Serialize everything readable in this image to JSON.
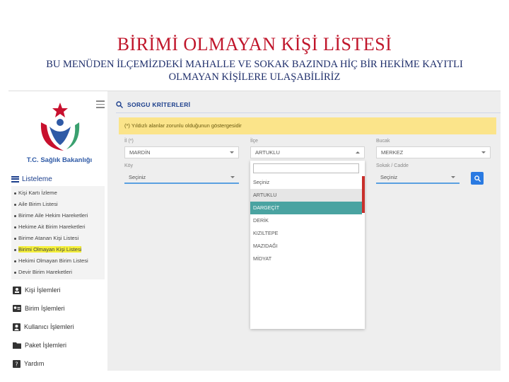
{
  "slide": {
    "title": "BİRİMİ OLMAYAN KİŞİ LİSTESİ",
    "subtitle": "BU MENÜDEN İLÇEMİZDEKİ MAHALLE VE SOKAK BAZINDA HİÇ BİR HEKİME KAYITLI OLMAYAN KİŞİLERE ULAŞABİLİRİZ"
  },
  "sidebar": {
    "ministry_name": "T.C. Sağlık Bakanlığı",
    "menu_head": "Listeleme",
    "submenu": [
      {
        "label": "Kişi Kartı İzleme"
      },
      {
        "label": "Aile Birim Listesi"
      },
      {
        "label": "Birime Aile Hekim Hareketleri"
      },
      {
        "label": "Hekime Ait Birim Hareketleri"
      },
      {
        "label": "Birime Atanan Kişi Listesi"
      },
      {
        "label": "Birimi Olmayan Kişi Listesi",
        "active": true
      },
      {
        "label": "Hekimi Olmayan Birim Listesi"
      },
      {
        "label": "Devir Birim Hareketleri"
      }
    ],
    "nav": [
      {
        "label": "Kişi İşlemleri",
        "icon": "person-card-icon"
      },
      {
        "label": "Birim İşlemleri",
        "icon": "id-card-icon"
      },
      {
        "label": "Kullanıcı İşlemleri",
        "icon": "user-icon"
      },
      {
        "label": "Paket İşlemleri",
        "icon": "folder-icon"
      },
      {
        "label": "Yardım",
        "icon": "help-icon"
      }
    ]
  },
  "query": {
    "header": "SORGU KRİTERLERİ",
    "notice": "(*) Yıldızlı alanlar zorunlu olduğunun göstergesidir",
    "fields": {
      "il_label": "İl (*)",
      "il_value": "MARDİN",
      "ilce_label": "İlçe",
      "ilce_value": "ARTUKLU",
      "bucak_label": "Bucak",
      "bucak_value": "MERKEZ",
      "koy_label": "Köy",
      "koy_value": "Seçiniz",
      "sokak_label": "Sokak / Cadde",
      "sokak_value": "Seçiniz"
    },
    "dropdown_options": [
      {
        "label": "Seçiniz"
      },
      {
        "label": "ARTUKLU",
        "state": "hover"
      },
      {
        "label": "DARGEÇİT",
        "state": "selected"
      },
      {
        "label": "DERİK"
      },
      {
        "label": "KIZILTEPE"
      },
      {
        "label": "MAZIDAĞI"
      },
      {
        "label": "MİDYAT"
      }
    ]
  },
  "colors": {
    "title": "#c0162b",
    "subtitle": "#1f2f6b",
    "accent_blue": "#2a7ae2",
    "notice_bg": "#fbe48a",
    "selected_teal": "#4aa3a1",
    "highlight_yellow": "#f5f03a"
  }
}
